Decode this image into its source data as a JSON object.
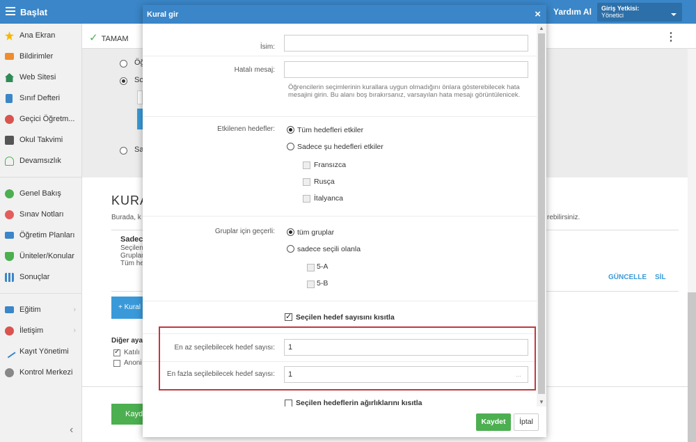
{
  "topbar": {
    "brand": "Başlat",
    "help": "Yardım Al",
    "auth_title": "Giriş Yetkisi:",
    "auth_value": "Yönetici"
  },
  "sidebar": {
    "items": [
      {
        "label": "Ana Ekran",
        "icon": "star-icon",
        "color": "#f5b800"
      },
      {
        "label": "Bildirimler",
        "icon": "envelope-icon",
        "color": "#f08c2e"
      },
      {
        "label": "Web Sitesi",
        "icon": "home-icon",
        "color": "#2e8b57"
      },
      {
        "label": "Sınıf Defteri",
        "icon": "notebook-icon",
        "color": "#3a86c8"
      },
      {
        "label": "Geçici Öğretm...",
        "icon": "user-icon",
        "color": "#d9534f"
      },
      {
        "label": "Okul Takvimi",
        "icon": "calendar-icon",
        "color": "#555555"
      },
      {
        "label": "Devamsızlık",
        "icon": "person-icon",
        "color": "#4caf50"
      },
      {
        "label": "Genel Bakış",
        "icon": "check-circle-icon",
        "color": "#4caf50"
      },
      {
        "label": "Sınav Notları",
        "icon": "grade-icon",
        "color": "#e35d5b"
      },
      {
        "label": "Öğretim Planları",
        "icon": "briefcase-icon",
        "color": "#3a86c8"
      },
      {
        "label": "Üniteler/Konular",
        "icon": "shield-icon",
        "color": "#4caf50"
      },
      {
        "label": "Sonuçlar",
        "icon": "bar-chart-icon",
        "color": "#3a86c8"
      },
      {
        "label": "Eğitim",
        "icon": "book-icon",
        "color": "#3a86c8"
      },
      {
        "label": "İletişim",
        "icon": "chat-icon",
        "color": "#d9534f"
      },
      {
        "label": "Kayıt Yönetimi",
        "icon": "pencil-icon",
        "color": "#3a86c8"
      },
      {
        "label": "Kontrol Merkezi",
        "icon": "gear-icon",
        "color": "#777777"
      }
    ]
  },
  "toolbar": {
    "ok_label": "TAMAM"
  },
  "background": {
    "radio1": "Öğ",
    "radio2": "Sc",
    "radio3": "Sa",
    "title": "KURA",
    "desc": "Burada, k",
    "desc_right": "rebilirsiniz.",
    "list_title": "Sadec",
    "list_line1": "Seçilen",
    "list_line2": "Gruplar",
    "list_line3": "Tüm he",
    "update": "GÜNCELLE",
    "delete": "SİL",
    "add_rule": "+ Kural",
    "other_settings": "Diğer aya",
    "cb1": "Katılı",
    "cb2": "Anoni",
    "save": "Kayd"
  },
  "modal": {
    "title": "Kural gir",
    "name_label": "İsim:",
    "name_value": "",
    "error_label": "Hatalı mesaj:",
    "error_value": "",
    "hint": "Öğrencilerin seçimlerinin kurallara uygun olmadığını önlara gösterebilecek hata mesajini girin. Bu alanı boş bırakırsanız, varsayılan hata mesajı görüntülenicek.",
    "targets_label": "Etkilenen hedefler:",
    "targets_all": "Tüm hedefleri etkiler",
    "targets_some": "Sadece şu hedefleri etkiler",
    "languages": [
      "Fransızca",
      "Rusça",
      "İtalyanca"
    ],
    "groups_label": "Gruplar için geçerli:",
    "groups_all": "tüm gruplar",
    "groups_some": "sadece seçili olanla",
    "groups": [
      "5-A",
      "5-B"
    ],
    "limit_count": "Seçilen hedef sayısını kısıtla",
    "min_label": "En az seçilebilecek hedef sayısı:",
    "min_value": "1",
    "max_label": "En fazla seçilebilecek hedef sayısı:",
    "max_value": "1",
    "limit_weights": "Seçilen hedeflerin ağırlıklarını kısıtla",
    "save": "Kaydet",
    "cancel": "İptal"
  }
}
